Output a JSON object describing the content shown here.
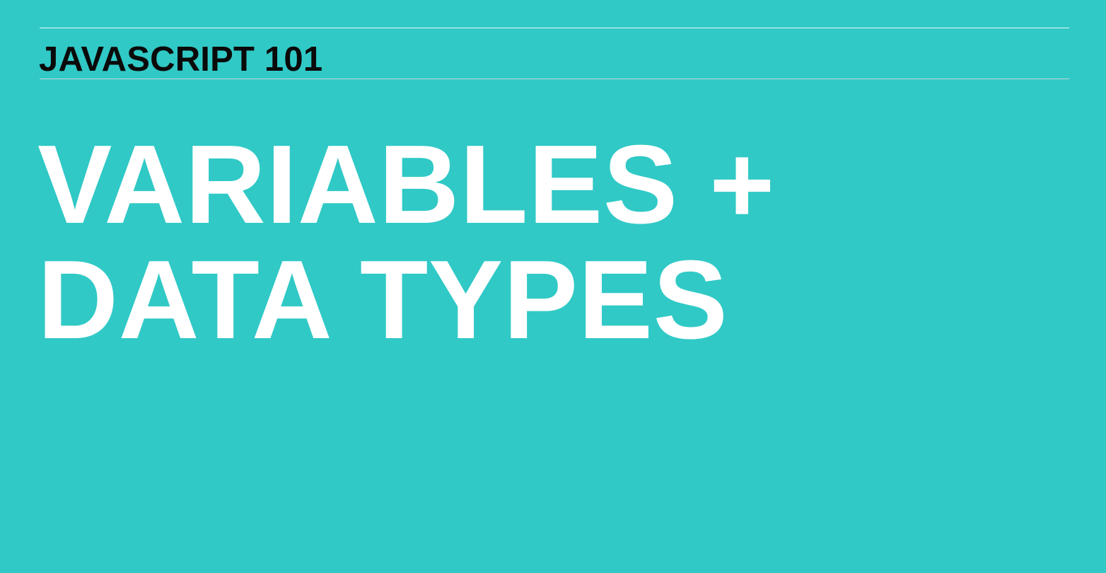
{
  "slide": {
    "course_label": "JAVASCRIPT 101",
    "title": "VARIABLES + DATA TYPES"
  },
  "colors": {
    "background": "#30c9c6",
    "course_label": "#0a0a0a",
    "title": "#ffffff",
    "rule": "#e8f7f6"
  }
}
